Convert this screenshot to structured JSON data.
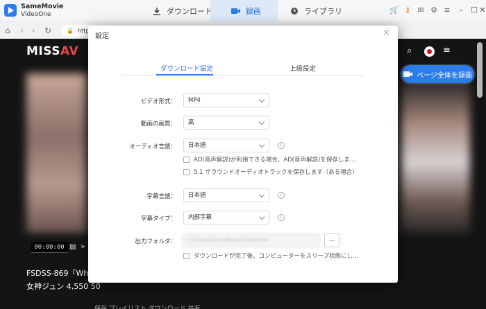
{
  "app": {
    "name_line1": "SameMovie",
    "name_line2": "VideoOne"
  },
  "tabs": [
    {
      "label": "ダウンロード"
    },
    {
      "label": "録画"
    },
    {
      "label": "ライブラリ"
    }
  ],
  "address": {
    "url": "http"
  },
  "page": {
    "logo_part1": "MISS",
    "logo_part2": "AV",
    "record_button": "ページ全体を録画",
    "time": "00:00:00",
    "video_title": "FSDSS-869「Whe",
    "video_subtitle": "女神ジュン 4,550 50",
    "bottom_actions": "保存   プレイリスト   ダウンロード   共有"
  },
  "modal": {
    "title": "設定",
    "close": "×",
    "tabs": {
      "download": "ダウンロード設定",
      "advanced": "上級設定"
    },
    "video_format": {
      "label": "ビデオ形式：",
      "value": "MP4"
    },
    "quality": {
      "label": "動画の画質：",
      "value": "高"
    },
    "audio_lang": {
      "label": "オーディオ言語：",
      "value": "日本語"
    },
    "checks": {
      "ad": "AD(音声解説)が利用できる場合、AD(音声解説)を保存しま...",
      "surround": "5.1 サラウンドオーディオトラックを保存します（ある場合）",
      "sleep": "ダウンロードが完了後、コンピューターをスリープ状態にし..."
    },
    "sub_lang": {
      "label": "字幕言語：",
      "value": "日本語"
    },
    "sub_type": {
      "label": "字幕タイプ：",
      "value": "内部字幕"
    },
    "output": {
      "label": "出力フォルダ：",
      "value": "C:\\Users\\SameMovie\\VideoOne",
      "browse": "..."
    },
    "info_icon": "i"
  },
  "colors": {
    "accent": "#2b7de9",
    "page_bg": "#141414"
  }
}
